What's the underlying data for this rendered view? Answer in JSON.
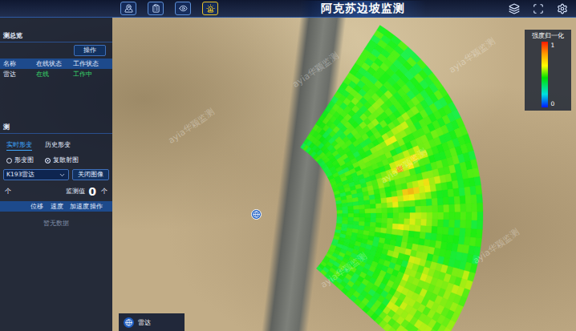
{
  "header": {
    "title": "阿克苏边坡监测",
    "tools": [
      {
        "kind": "pin",
        "alert": false
      },
      {
        "kind": "list",
        "alert": false
      },
      {
        "kind": "eye",
        "alert": false
      },
      {
        "kind": "alarm",
        "alert": true
      }
    ],
    "actions": [
      {
        "kind": "layers"
      },
      {
        "kind": "fullscreen"
      },
      {
        "kind": "settings"
      }
    ]
  },
  "watermark": "ayia华颖监测",
  "device_panel": {
    "title": "测总览",
    "action_button": "操作",
    "columns": [
      "名称",
      "在线状态",
      "工作状态"
    ],
    "rows": [
      {
        "cells": [
          "雷达",
          "在线",
          "工作中"
        ],
        "selected": false
      }
    ]
  },
  "monitor_panel": {
    "title": "测",
    "tabs": [
      {
        "label": "实时形变",
        "selected": true
      },
      {
        "label": "历史形变",
        "selected": false
      }
    ],
    "radios": [
      {
        "label": "形变图",
        "selected": false
      },
      {
        "label": "复散射图",
        "selected": true
      }
    ],
    "device_select": "K193雷达",
    "close_button": "关闭图像",
    "counter": {
      "left": "个",
      "label": "监测值",
      "value": "0",
      "right": "个"
    },
    "columns": [
      "位移",
      "速度",
      "加速度",
      "操作"
    ],
    "empty_text": "暂无数据"
  },
  "legend": {
    "title": "强度归一化",
    "max": "1",
    "min": "0"
  },
  "layer_legend": {
    "label": "雷达"
  }
}
